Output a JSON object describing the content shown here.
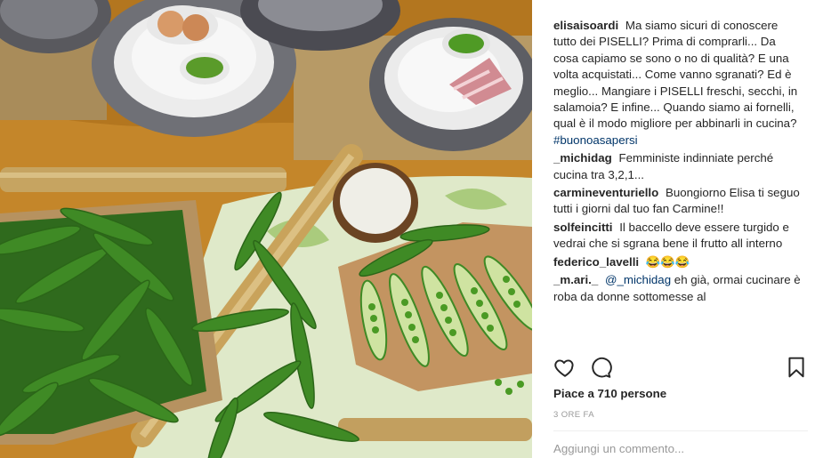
{
  "post": {
    "image_alt": "Peas on a decorated table",
    "caption": {
      "user": "elisaisoardi",
      "text": "Ma siamo sicuri di conoscere tutto dei PISELLI? Prima di comprarli... Da cosa capiamo se sono o no di qualità? E una volta acquistati... Come vanno sgranati? Ed è meglio... Mangiare i PISELLI freschi, secchi, in salamoia? E infine... Quando siamo ai fornelli, qual è il modo migliore per abbinarli in cucina?",
      "hashtag": "#buonoasapersi"
    },
    "comments": [
      {
        "user": "_michidag",
        "text": "Femministe indinniate perché cucina tra 3,2,1..."
      },
      {
        "user": "carmineventuriello",
        "text": "Buongiorno Elisa ti seguo tutti i giorni dal tuo fan Carmine!!"
      },
      {
        "user": "solfeincitti",
        "text": "Il baccello deve essere turgido e vedrai che si sgrana bene il frutto all interno"
      },
      {
        "user": "federico_lavelli",
        "text": "😂😂😂"
      },
      {
        "user": "_m.ari._",
        "mention": "@_michidag",
        "text": "eh già, ormai cucinare è roba da donne sottomesse al"
      }
    ],
    "likes": "Piace a 710 persone",
    "time": "3 ORE FA",
    "add_comment_placeholder": "Aggiungi un commento..."
  },
  "icons": {
    "like": "heart-icon",
    "comment": "comment-bubble-icon",
    "save": "bookmark-icon"
  }
}
